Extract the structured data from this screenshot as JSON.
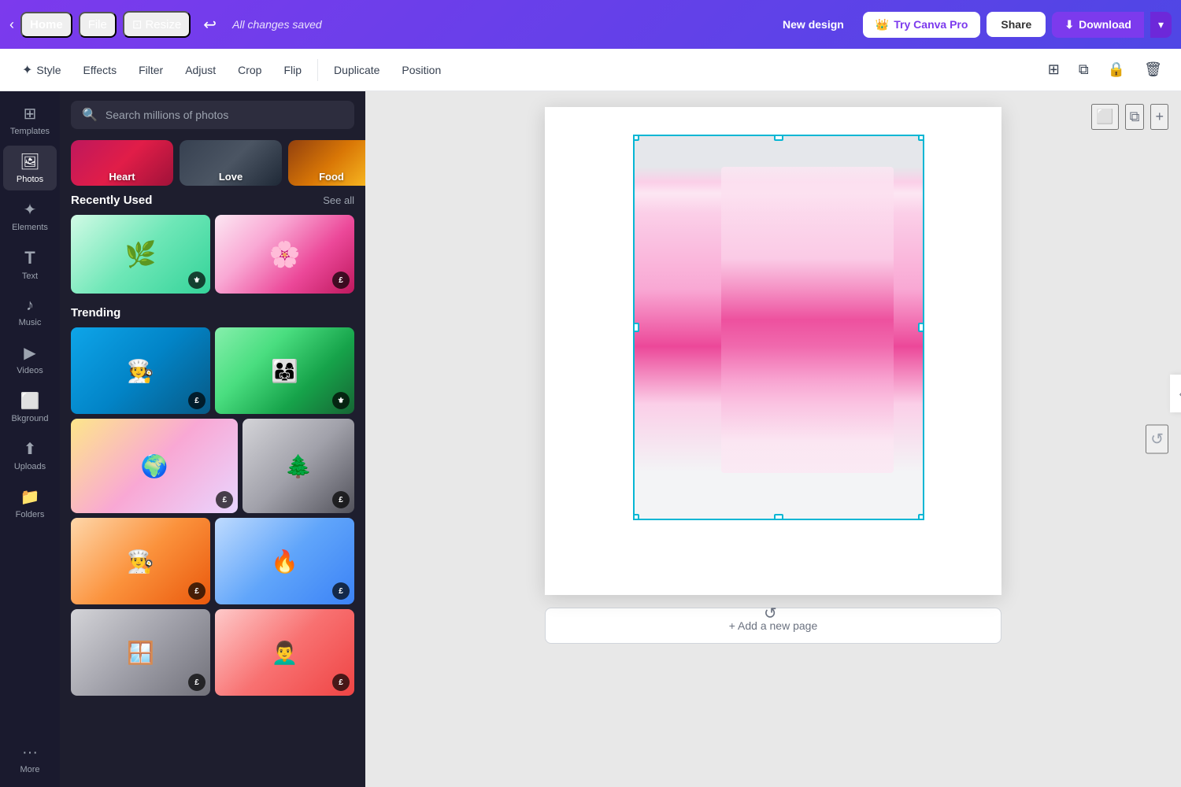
{
  "topNav": {
    "home": "Home",
    "file": "File",
    "resize": "Resize",
    "saved": "All changes saved",
    "newDesign": "New design",
    "tryPro": "Try Canva Pro",
    "share": "Share",
    "download": "Download"
  },
  "toolbar": {
    "style": "Style",
    "effects": "Effects",
    "filter": "Filter",
    "adjust": "Adjust",
    "crop": "Crop",
    "flip": "Flip",
    "duplicate": "Duplicate",
    "position": "Position"
  },
  "sidebar": {
    "items": [
      {
        "id": "templates",
        "label": "Templates",
        "icon": "⊞"
      },
      {
        "id": "photos",
        "label": "Photos",
        "icon": "🖼"
      },
      {
        "id": "elements",
        "label": "Elements",
        "icon": "✦"
      },
      {
        "id": "text",
        "label": "Text",
        "icon": "T"
      },
      {
        "id": "music",
        "label": "Music",
        "icon": "♪"
      },
      {
        "id": "videos",
        "label": "Videos",
        "icon": "▶"
      },
      {
        "id": "background",
        "label": "Bkground",
        "icon": "⬜"
      },
      {
        "id": "uploads",
        "label": "Uploads",
        "icon": "⬆"
      },
      {
        "id": "folders",
        "label": "Folders",
        "icon": "📁"
      },
      {
        "id": "more",
        "label": "More",
        "icon": "···"
      }
    ]
  },
  "panel": {
    "searchPlaceholder": "Search millions of photos",
    "categories": [
      {
        "id": "heart",
        "label": "Heart"
      },
      {
        "id": "love",
        "label": "Love"
      },
      {
        "id": "food",
        "label": "Food"
      }
    ],
    "recentlyUsed": {
      "title": "Recently Used",
      "seeAll": "See all"
    },
    "trending": {
      "title": "Trending"
    }
  },
  "canvas": {
    "addPage": "+ Add a new page"
  }
}
